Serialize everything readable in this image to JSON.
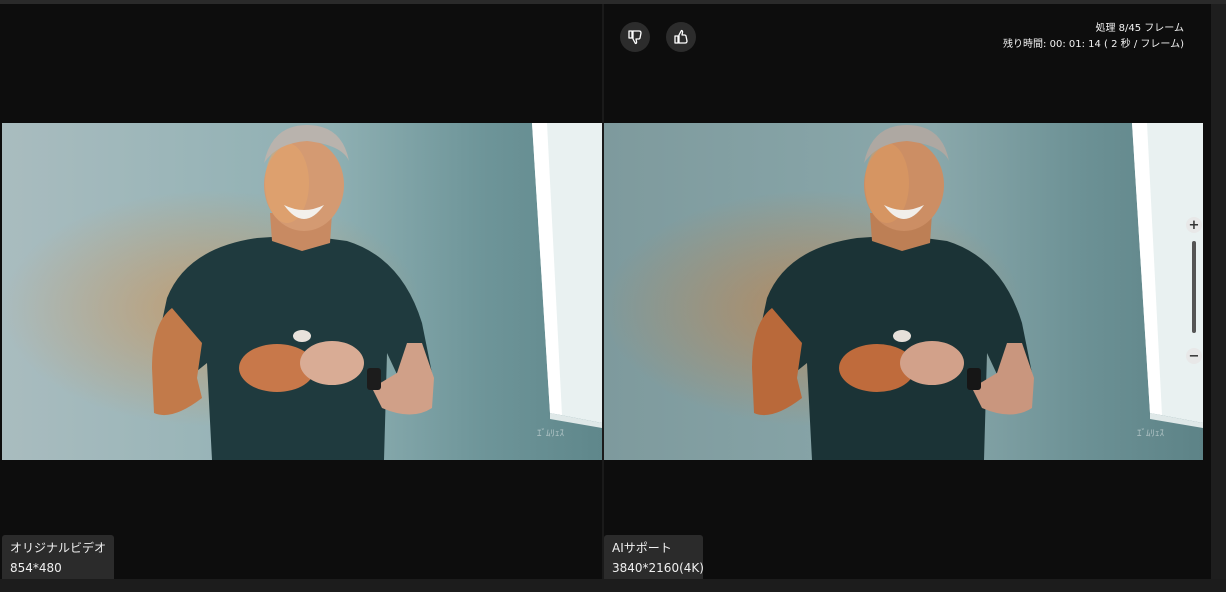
{
  "progress": {
    "frames_text": "処理 8/45 フレーム",
    "remaining_text": "残り時間: 00: 01: 14 ( 2 秒 / フレーム)"
  },
  "vote": {
    "dislike_icon": "thumbs-down-icon",
    "like_icon": "thumbs-up-icon"
  },
  "panels": {
    "original": {
      "label": "オリジナルビデオ",
      "resolution": "854*480"
    },
    "enhanced": {
      "label": "AIサポート",
      "resolution": "3840*2160(4K)"
    }
  },
  "zoom": {
    "in_symbol": "+",
    "out_symbol": "−"
  }
}
